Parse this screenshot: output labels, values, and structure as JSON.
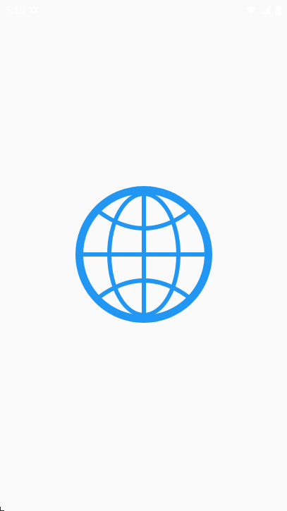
{
  "status_bar": {
    "time": "5:10",
    "icons": [
      "notification-icon",
      "wifi-icon",
      "signal-icon",
      "battery-icon"
    ]
  },
  "splash": {
    "logo_icon": "globe-icon",
    "logo_color": "#2196f3",
    "background_color": "#fafafa"
  }
}
